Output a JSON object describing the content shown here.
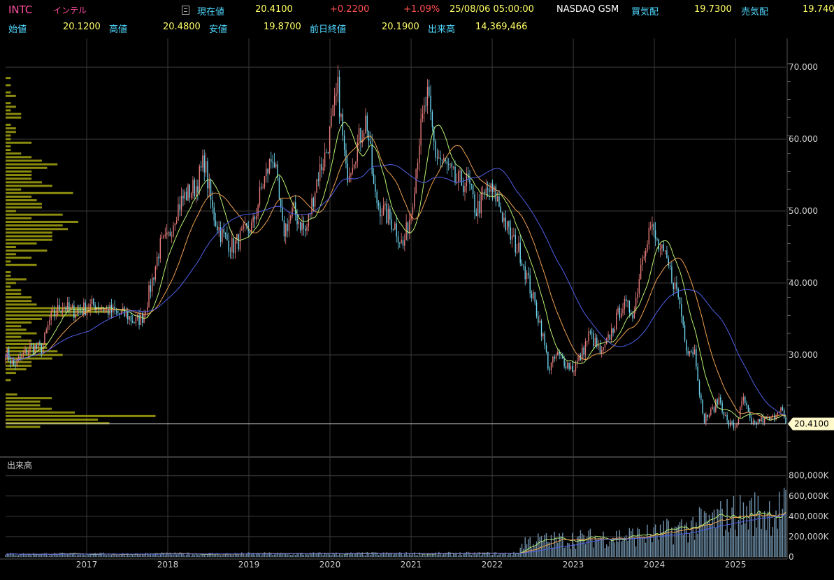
{
  "header": {
    "symbol": "INTC",
    "name": "インテル",
    "current_label": "現在値",
    "current_value": "20.4100",
    "change": "+0.2200",
    "change_pct": "+1.09%",
    "datetime": "25/08/06  05:00:00",
    "market": "NASDAQ GSM",
    "bid_label": "買気配",
    "bid_value": "19.7300",
    "ask_label": "売気配",
    "ask_value": "19.740",
    "open_label": "始値",
    "open_value": "20.1200",
    "high_label": "高値",
    "high_value": "20.4800",
    "low_label": "安値",
    "low_value": "19.8700",
    "prev_close_label": "前日終値",
    "prev_close_value": "20.1900",
    "volume_label": "出来高",
    "volume_value": "14,369,466"
  },
  "colors": {
    "up": "#e97c7c",
    "down": "#6fd6f0",
    "ma_short": "#b8f070",
    "ma_mid": "#f0a050",
    "ma_long": "#5060e8",
    "volume_profile": "#9a9a10",
    "grid": "#3a3a3a",
    "price_tag_bg": "#fff9cc"
  },
  "chart_data": {
    "type": "candlestick",
    "price_axis": {
      "ticks": [
        "70.000",
        "60.000",
        "50.000",
        "40.000",
        "30.000"
      ],
      "tick_values": [
        70,
        60,
        50,
        40,
        30
      ],
      "range": [
        16,
        74
      ]
    },
    "current_price_tag": "20.4100",
    "current_price": 20.41,
    "x_axis": {
      "ticks": [
        "2017",
        "2018",
        "2019",
        "2020",
        "2021",
        "2022",
        "2023",
        "2024",
        "2025"
      ],
      "range": [
        2016.0,
        2025.62
      ]
    },
    "price_path": [
      [
        2016.0,
        30.5
      ],
      [
        2016.1,
        28.5
      ],
      [
        2016.3,
        31
      ],
      [
        2016.45,
        31
      ],
      [
        2016.55,
        35
      ],
      [
        2016.7,
        37
      ],
      [
        2016.8,
        36
      ],
      [
        2017.0,
        36.5
      ],
      [
        2017.1,
        37
      ],
      [
        2017.3,
        36
      ],
      [
        2017.5,
        35.5
      ],
      [
        2017.6,
        34.5
      ],
      [
        2017.7,
        35.5
      ],
      [
        2017.8,
        40
      ],
      [
        2017.9,
        45
      ],
      [
        2018.0,
        46
      ],
      [
        2018.1,
        50
      ],
      [
        2018.2,
        52
      ],
      [
        2018.35,
        53.5
      ],
      [
        2018.45,
        57
      ],
      [
        2018.55,
        50
      ],
      [
        2018.65,
        47
      ],
      [
        2018.8,
        45
      ],
      [
        2018.95,
        47
      ],
      [
        2019.05,
        48
      ],
      [
        2019.15,
        53
      ],
      [
        2019.3,
        58
      ],
      [
        2019.42,
        47
      ],
      [
        2019.55,
        50
      ],
      [
        2019.7,
        47
      ],
      [
        2019.85,
        55
      ],
      [
        2019.95,
        58
      ],
      [
        2020.1,
        67
      ],
      [
        2020.2,
        55
      ],
      [
        2020.3,
        58
      ],
      [
        2020.45,
        63
      ],
      [
        2020.55,
        52
      ],
      [
        2020.65,
        50
      ],
      [
        2020.8,
        48
      ],
      [
        2020.9,
        45
      ],
      [
        2021.0,
        50
      ],
      [
        2021.1,
        60
      ],
      [
        2021.2,
        66
      ],
      [
        2021.3,
        58
      ],
      [
        2021.45,
        56
      ],
      [
        2021.55,
        54
      ],
      [
        2021.7,
        54
      ],
      [
        2021.8,
        50
      ],
      [
        2021.95,
        53
      ],
      [
        2022.05,
        52
      ],
      [
        2022.2,
        47
      ],
      [
        2022.35,
        44
      ],
      [
        2022.5,
        38
      ],
      [
        2022.6,
        34
      ],
      [
        2022.7,
        28
      ],
      [
        2022.8,
        30
      ],
      [
        2022.9,
        29
      ],
      [
        2023.0,
        28
      ],
      [
        2023.1,
        30
      ],
      [
        2023.2,
        33
      ],
      [
        2023.35,
        30
      ],
      [
        2023.5,
        34
      ],
      [
        2023.6,
        37
      ],
      [
        2023.75,
        36
      ],
      [
        2023.85,
        44
      ],
      [
        2023.95,
        48
      ],
      [
        2024.05,
        45
      ],
      [
        2024.15,
        43
      ],
      [
        2024.3,
        38
      ],
      [
        2024.4,
        31
      ],
      [
        2024.5,
        30.5
      ],
      [
        2024.6,
        21
      ],
      [
        2024.7,
        22
      ],
      [
        2024.8,
        24
      ],
      [
        2024.9,
        20.5
      ],
      [
        2025.0,
        20
      ],
      [
        2025.1,
        24
      ],
      [
        2025.2,
        20
      ],
      [
        2025.3,
        21
      ],
      [
        2025.45,
        21
      ],
      [
        2025.55,
        23
      ],
      [
        2025.62,
        20.41
      ]
    ],
    "ma_periods": [
      13,
      26,
      52
    ],
    "volume_axis": {
      "ticks": [
        "800,000K",
        "600,000K",
        "400,000K",
        "200,000K",
        "0"
      ],
      "tick_values": [
        800000,
        600000,
        400000,
        200000,
        0
      ],
      "range": [
        0,
        860000
      ]
    },
    "volume_label": "出来高",
    "volume_levels": [
      [
        2016.0,
        25000
      ],
      [
        2022.3,
        30000
      ],
      [
        2022.4,
        140000
      ],
      [
        2023.0,
        160000
      ],
      [
        2024.0,
        200000
      ],
      [
        2024.5,
        280000
      ],
      [
        2025.0,
        380000
      ],
      [
        2025.62,
        420000
      ]
    ]
  }
}
